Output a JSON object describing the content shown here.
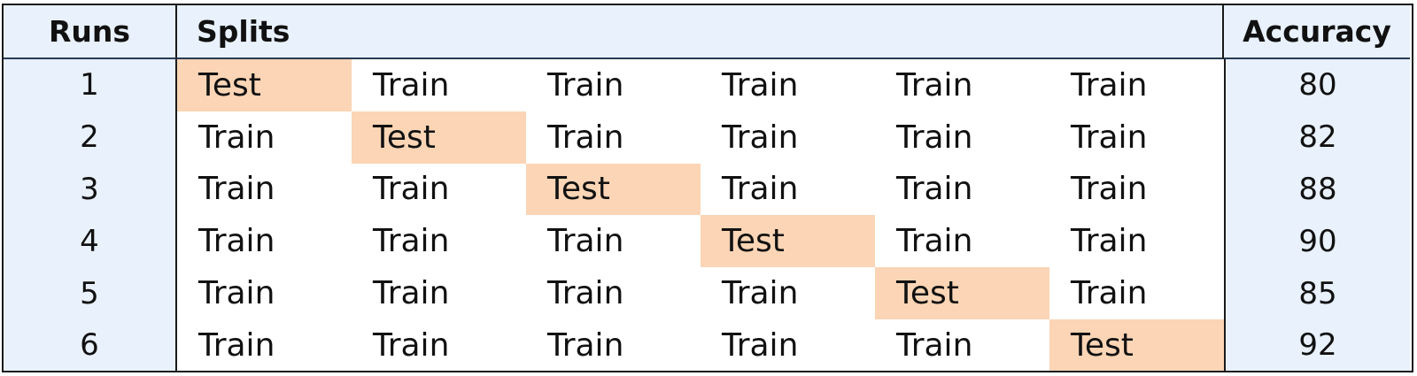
{
  "headers": {
    "runs": "Runs",
    "splits": "Splits",
    "accuracy": "Accuracy"
  },
  "rows": [
    {
      "run": "1",
      "splits": [
        "Test",
        "Train",
        "Train",
        "Train",
        "Train",
        "Train"
      ],
      "accuracy": "80"
    },
    {
      "run": "2",
      "splits": [
        "Train",
        "Test",
        "Train",
        "Train",
        "Train",
        "Train"
      ],
      "accuracy": "82"
    },
    {
      "run": "3",
      "splits": [
        "Train",
        "Train",
        "Test",
        "Train",
        "Train",
        "Train"
      ],
      "accuracy": "88"
    },
    {
      "run": "4",
      "splits": [
        "Train",
        "Train",
        "Train",
        "Test",
        "Train",
        "Train"
      ],
      "accuracy": "90"
    },
    {
      "run": "5",
      "splits": [
        "Train",
        "Train",
        "Train",
        "Train",
        "Test",
        "Train"
      ],
      "accuracy": "85"
    },
    {
      "run": "6",
      "splits": [
        "Train",
        "Train",
        "Train",
        "Train",
        "Train",
        "Test"
      ],
      "accuracy": "92"
    }
  ],
  "colors": {
    "header_bg": "#e8f1fc",
    "test_highlight": "#fbd5b5",
    "train_bg": "#ffffff",
    "border": "#1a1a1a"
  }
}
